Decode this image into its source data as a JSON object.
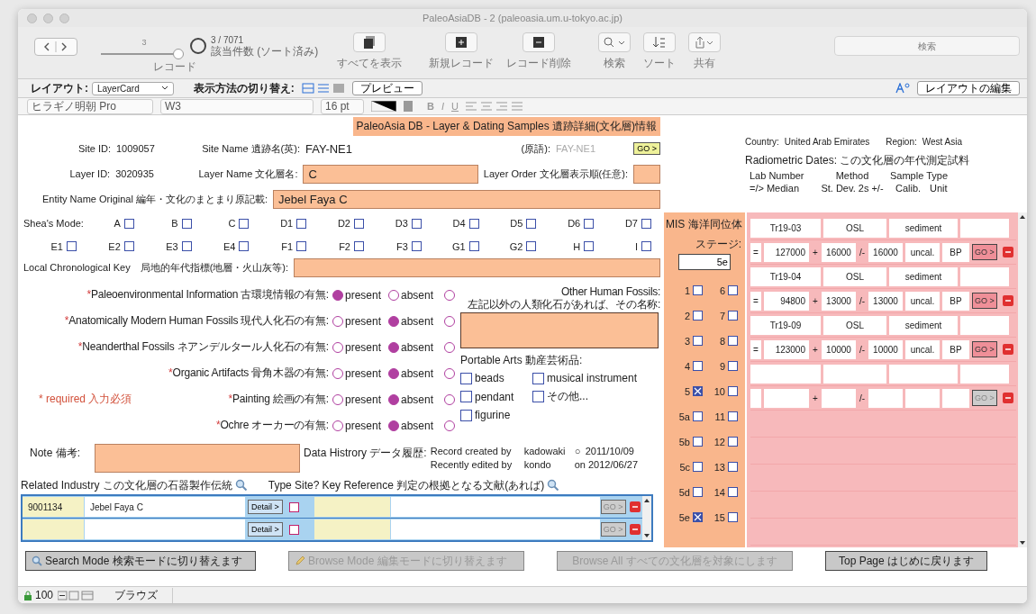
{
  "window": {
    "title": "PaleoAsiaDB - 2 (paleoasia.um.u-tokyo.ac.jp)"
  },
  "toolbar": {
    "record": "3",
    "record_label": "レコード",
    "count": "3 / 7071",
    "count_label": "該当件数 (ソート済み)",
    "show_all": "すべてを表示",
    "new_record": "新規レコード",
    "delete_record": "レコード削除",
    "find": "検索",
    "sort": "ソート",
    "share": "共有",
    "search_placeholder": "検索"
  },
  "layout_bar": {
    "layout_label": "レイアウト:",
    "layout": "LayerCard",
    "view_label": "表示方法の切り替え:",
    "preview": "プレビュー",
    "edit_layout": "レイアウトの編集"
  },
  "format_bar": {
    "font": "ヒラギノ明朝 Pro",
    "style": "W3",
    "size": "16 pt",
    "bold": "B",
    "italic": "I",
    "underline": "U"
  },
  "form": {
    "header": "PaleoAsia DB - Layer & Dating Samples 遺跡詳細(文化層)情報",
    "site_id_label": "Site ID:",
    "site_id": "1009057",
    "site_name_label": "Site Name 遺跡名(英):",
    "site_name": "FAY-NE1",
    "original_label": "(原語):",
    "original": "FAY-NE1",
    "go": "GO >",
    "layer_id_label": "Layer ID:",
    "layer_id": "3020935",
    "layer_name_label": "Layer Name 文化層名:",
    "layer_name": "C",
    "layer_order_label": "Layer Order 文化層表示順(任意):",
    "entity_label": "Entity Name Original 編年・文化のまとまり原記載:",
    "entity": "Jebel Faya C",
    "shea_label": "Shea's Mode:",
    "shea": [
      {
        "label": "A",
        "checked": false
      },
      {
        "label": "B",
        "checked": false
      },
      {
        "label": "C",
        "checked": false
      },
      {
        "label": "D1",
        "checked": false
      },
      {
        "label": "D2",
        "checked": false
      },
      {
        "label": "D3",
        "checked": false
      },
      {
        "label": "D4",
        "checked": false
      },
      {
        "label": "D5",
        "checked": false
      },
      {
        "label": "D6",
        "checked": false
      },
      {
        "label": "D7",
        "checked": false
      },
      {
        "label": "E1",
        "checked": false
      },
      {
        "label": "E2",
        "checked": false
      },
      {
        "label": "E3",
        "checked": false
      },
      {
        "label": "E4",
        "checked": false
      },
      {
        "label": "F1",
        "checked": false
      },
      {
        "label": "F2",
        "checked": false
      },
      {
        "label": "F3",
        "checked": false
      },
      {
        "label": "G1",
        "checked": false
      },
      {
        "label": "G2",
        "checked": false
      },
      {
        "label": "H",
        "checked": false
      },
      {
        "label": "I",
        "checked": false
      }
    ],
    "local_key_label": "Local Chronological Key　局地的年代指標(地層・火山灰等):",
    "presence": [
      {
        "mark": "*",
        "label": "Paleoenvironmental Information 古環境情報の有無:",
        "options": [
          {
            "label": "present",
            "selected": true
          },
          {
            "label": "absent",
            "selected": false
          },
          {
            "selected": false
          }
        ]
      },
      {
        "mark": "*",
        "label": "Anatomically Modern Human Fossils 現代人化石の有無:",
        "options": [
          {
            "label": "present",
            "selected": false
          },
          {
            "label": "absent",
            "selected": true
          },
          {
            "selected": false
          }
        ]
      },
      {
        "mark": "*",
        "label": "Neanderthal Fossils ネアンデルタール人化石の有無:",
        "options": [
          {
            "label": "present",
            "selected": false
          },
          {
            "label": "absent",
            "selected": true
          },
          {
            "selected": false
          }
        ]
      },
      {
        "mark": "*",
        "label": "Organic Artifacts 骨角木器の有無:",
        "options": [
          {
            "label": "present",
            "selected": false
          },
          {
            "label": "absent",
            "selected": true
          },
          {
            "selected": false
          }
        ]
      },
      {
        "mark": "*",
        "label": "Painting 絵画の有無:",
        "options": [
          {
            "label": "present",
            "selected": false
          },
          {
            "label": "absent",
            "selected": true
          },
          {
            "selected": false
          }
        ]
      },
      {
        "mark": "*",
        "label": "Ochre オーカーの有無:",
        "options": [
          {
            "label": "present",
            "selected": false
          },
          {
            "label": "absent",
            "selected": true
          },
          {
            "selected": false
          }
        ]
      }
    ],
    "required_note": "* required 入力必須",
    "other_fossils_label": "Other Human Fossils:",
    "other_fossils_hint": "左記以外の人類化石があれば、その名称:",
    "arts_label": "Portable Arts 動産芸術品:",
    "arts": [
      {
        "label": "beads",
        "checked": false
      },
      {
        "label": "musical instrument",
        "checked": false
      },
      {
        "label": "pendant",
        "checked": false
      },
      {
        "label": "その他...",
        "checked": false
      },
      {
        "label": "figurine",
        "checked": false
      }
    ],
    "note_label": "Note 備考:",
    "history": {
      "label": "Data Histrory データ履歴:",
      "created_label": "Record created by",
      "created_by": "kadowaki",
      "created_mark": "○",
      "created_on": "2011/10/09",
      "edited_label": "Recently edited by",
      "edited_by": "kondo",
      "edited_on": "on 2012/06/27"
    },
    "industry_label": "Related Industry この文化層の石器製作伝統",
    "type_site_label": "Type Site?",
    "key_ref_label": "Key Reference 判定の根拠となる文献(あれば)",
    "industries": [
      {
        "id": "9001134",
        "name": "Jebel Faya C",
        "detail": "Detail >",
        "type_site": false,
        "go": "GO >",
        "go_disabled": true
      },
      {
        "detail": "Detail >",
        "type_site": false,
        "go": "GO >",
        "go_disabled": true
      }
    ]
  },
  "mis": {
    "label": "MIS 海洋同位体",
    "stage_label": "ステージ:",
    "stage": "5e",
    "stages": [
      {
        "label": "1",
        "checked": false
      },
      {
        "label": "6",
        "checked": false
      },
      {
        "label": "2",
        "checked": false
      },
      {
        "label": "7",
        "checked": false
      },
      {
        "label": "3",
        "checked": false
      },
      {
        "label": "8",
        "checked": false
      },
      {
        "label": "4",
        "checked": false
      },
      {
        "label": "9",
        "checked": false
      },
      {
        "label": "5",
        "checked": true
      },
      {
        "label": "10",
        "checked": false
      },
      {
        "label": "5a",
        "checked": false
      },
      {
        "label": "11",
        "checked": false
      },
      {
        "label": "5b",
        "checked": false
      },
      {
        "label": "12",
        "checked": false
      },
      {
        "label": "5c",
        "checked": false
      },
      {
        "label": "13",
        "checked": false
      },
      {
        "label": "5d",
        "checked": false
      },
      {
        "label": "14",
        "checked": false
      },
      {
        "label": "5e",
        "checked": true
      },
      {
        "label": "15",
        "checked": false
      }
    ]
  },
  "location": {
    "country_label": "Country:",
    "country": "United Arab Emirates",
    "region_label": "Region:",
    "region": "West Asia"
  },
  "dates": {
    "label": "Radiometric Dates: この文化層の年代測定試料",
    "header_1": [
      "Lab Number",
      "Method",
      "Sample Type"
    ],
    "header_2": [
      "=/> Median",
      "St. Dev. 2s +/-",
      "Calib.",
      "Unit"
    ],
    "rows": [
      {
        "lab": "Tr19-03",
        "method": "OSL",
        "sample": "sediment",
        "rel": "=",
        "median": "127000",
        "plus": "+",
        "dev_plus": "16000",
        "minus": "/-",
        "dev_minus": "16000",
        "calib": "uncal.",
        "unit": "BP",
        "go": "GO >",
        "go_disabled": false
      },
      {
        "lab": "Tr19-04",
        "method": "OSL",
        "sample": "sediment",
        "rel": "=",
        "median": "94800",
        "plus": "+",
        "dev_plus": "13000",
        "minus": "/-",
        "dev_minus": "13000",
        "calib": "uncal.",
        "unit": "BP",
        "go": "GO >",
        "go_disabled": false
      },
      {
        "lab": "Tr19-09",
        "method": "OSL",
        "sample": "sediment",
        "rel": "=",
        "median": "123000",
        "plus": "+",
        "dev_plus": "10000",
        "minus": "/-",
        "dev_minus": "10000",
        "calib": "uncal.",
        "unit": "BP",
        "go": "GO >",
        "go_disabled": false
      },
      {
        "plus": "+",
        "minus": "/-",
        "go": "GO >",
        "go_disabled": true
      }
    ]
  },
  "buttons": [
    {
      "label": "Search Mode 検索モードに切り替えます",
      "disabled": false
    },
    {
      "label": "Browse Mode 編集モードに切り替えます",
      "disabled": true
    },
    {
      "label": "Browse All すべての文化層を対象にします",
      "disabled": true
    },
    {
      "label": "Top Page はじめに戻ります",
      "disabled": false
    }
  ],
  "status_bar": {
    "zoom": "100",
    "mode": "ブラウズ"
  }
}
